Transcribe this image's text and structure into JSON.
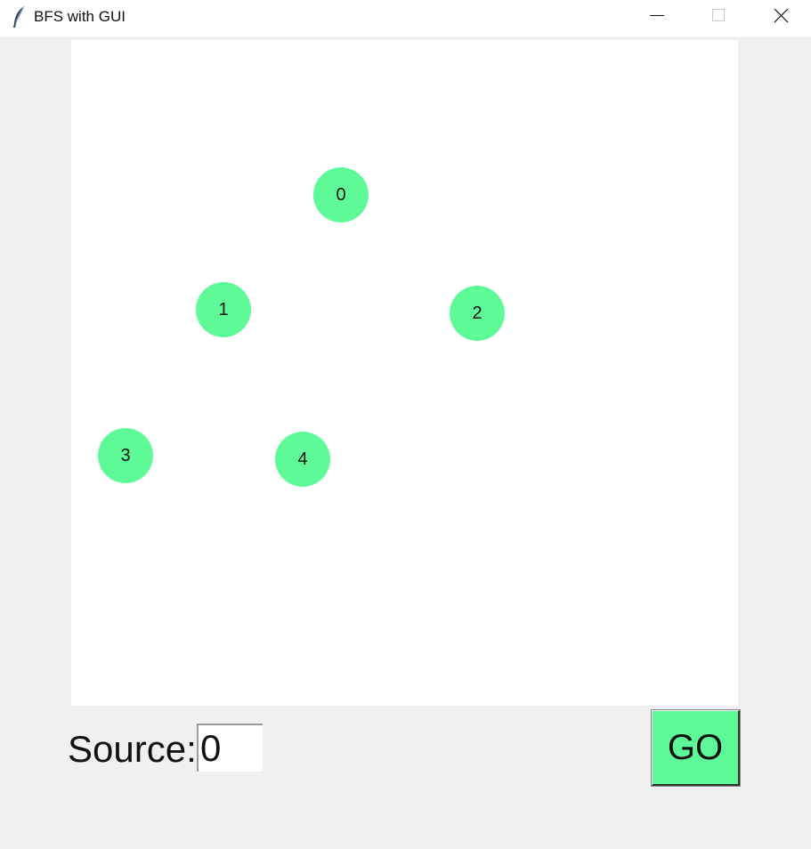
{
  "window": {
    "title": "BFS with GUI",
    "app_icon": "feather-icon",
    "controls": [
      "minimize-icon",
      "maximize-icon",
      "close-icon"
    ]
  },
  "graph": {
    "node_color": "#5efa97",
    "nodes": [
      {
        "label": "0"
      },
      {
        "label": "1"
      },
      {
        "label": "2"
      },
      {
        "label": "3"
      },
      {
        "label": "4"
      }
    ]
  },
  "controls": {
    "source_label": "Source:",
    "source_value": "0",
    "go_label": "GO",
    "go_color": "#5efa97"
  }
}
